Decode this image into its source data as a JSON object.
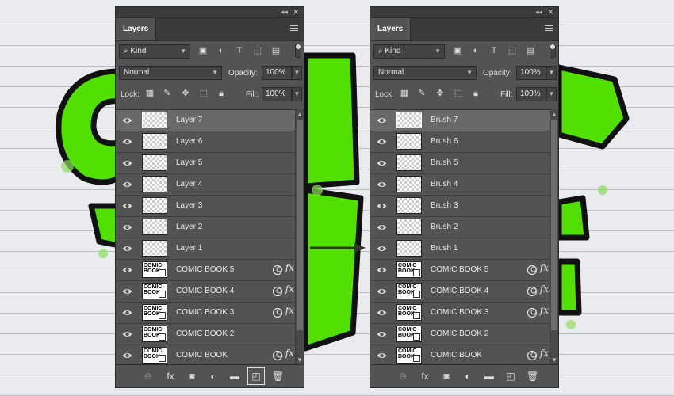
{
  "panels": {
    "left": {
      "tab": "Layers",
      "filter_kind": "Kind",
      "blend_mode": "Normal",
      "opacity_label": "Opacity:",
      "opacity": "100%",
      "lock_label": "Lock:",
      "fill_label": "Fill:",
      "fill": "100%",
      "layers": [
        {
          "name": "Layer 7",
          "type": "empty",
          "fx": false,
          "active": true
        },
        {
          "name": "Layer 6",
          "type": "empty",
          "fx": false
        },
        {
          "name": "Layer 5",
          "type": "empty",
          "fx": false
        },
        {
          "name": "Layer 4",
          "type": "empty",
          "fx": false
        },
        {
          "name": "Layer 3",
          "type": "empty",
          "fx": false
        },
        {
          "name": "Layer 2",
          "type": "empty",
          "fx": false
        },
        {
          "name": "Layer 1",
          "type": "empty",
          "fx": false
        },
        {
          "name": "COMIC BOOK 5",
          "type": "smart",
          "fx": true
        },
        {
          "name": "COMIC BOOK 4",
          "type": "smart",
          "fx": true
        },
        {
          "name": "COMIC BOOK 3",
          "type": "smart",
          "fx": true
        },
        {
          "name": "COMIC BOOK 2",
          "type": "smart",
          "fx": false
        },
        {
          "name": "COMIC BOOK",
          "type": "smart",
          "fx": true
        }
      ]
    },
    "right": {
      "tab": "Layers",
      "filter_kind": "Kind",
      "blend_mode": "Normal",
      "opacity_label": "Opacity:",
      "opacity": "100%",
      "lock_label": "Lock:",
      "fill_label": "Fill:",
      "fill": "100%",
      "layers": [
        {
          "name": "Brush 7",
          "type": "empty",
          "fx": false,
          "active": true
        },
        {
          "name": "Brush 6",
          "type": "empty",
          "fx": false
        },
        {
          "name": "Brush 5",
          "type": "empty",
          "fx": false
        },
        {
          "name": "Brush 4",
          "type": "empty",
          "fx": false
        },
        {
          "name": "Brush 3",
          "type": "empty",
          "fx": false
        },
        {
          "name": "Brush 2",
          "type": "empty",
          "fx": false
        },
        {
          "name": "Brush 1",
          "type": "empty",
          "fx": false
        },
        {
          "name": "COMIC BOOK 5",
          "type": "smart",
          "fx": true
        },
        {
          "name": "COMIC BOOK 4",
          "type": "smart",
          "fx": true
        },
        {
          "name": "COMIC BOOK 3",
          "type": "smart",
          "fx": true
        },
        {
          "name": "COMIC BOOK 2",
          "type": "smart",
          "fx": false
        },
        {
          "name": "COMIC BOOK",
          "type": "smart",
          "fx": true
        }
      ]
    }
  },
  "thumb_text": [
    "COMIC",
    "BOOK"
  ],
  "fx_symbol": "fx",
  "colors": {
    "panel_bg": "#535353",
    "panel_dark": "#3b3b3b",
    "active_row": "#696969",
    "comic_green": "#4fe000",
    "comic_outline": "#111111"
  },
  "icons": {
    "header": [
      "collapse-icon",
      "close-icon",
      "panel-menu-icon"
    ],
    "filter": [
      "search-icon",
      "filter-image-icon",
      "filter-adjustment-icon",
      "filter-position-icon",
      "filter-type-icon",
      "filter-shape-icon",
      "filter-smartobject-icon"
    ],
    "lock": [
      "lock-transparency-icon",
      "lock-paint-icon",
      "lock-position-icon",
      "lock-artboard-icon",
      "lock-all-icon"
    ],
    "bottom": [
      "link-layers-icon",
      "add-style-icon",
      "add-mask-icon",
      "new-adjustment-icon",
      "new-group-icon",
      "new-layer-icon",
      "delete-icon"
    ]
  }
}
